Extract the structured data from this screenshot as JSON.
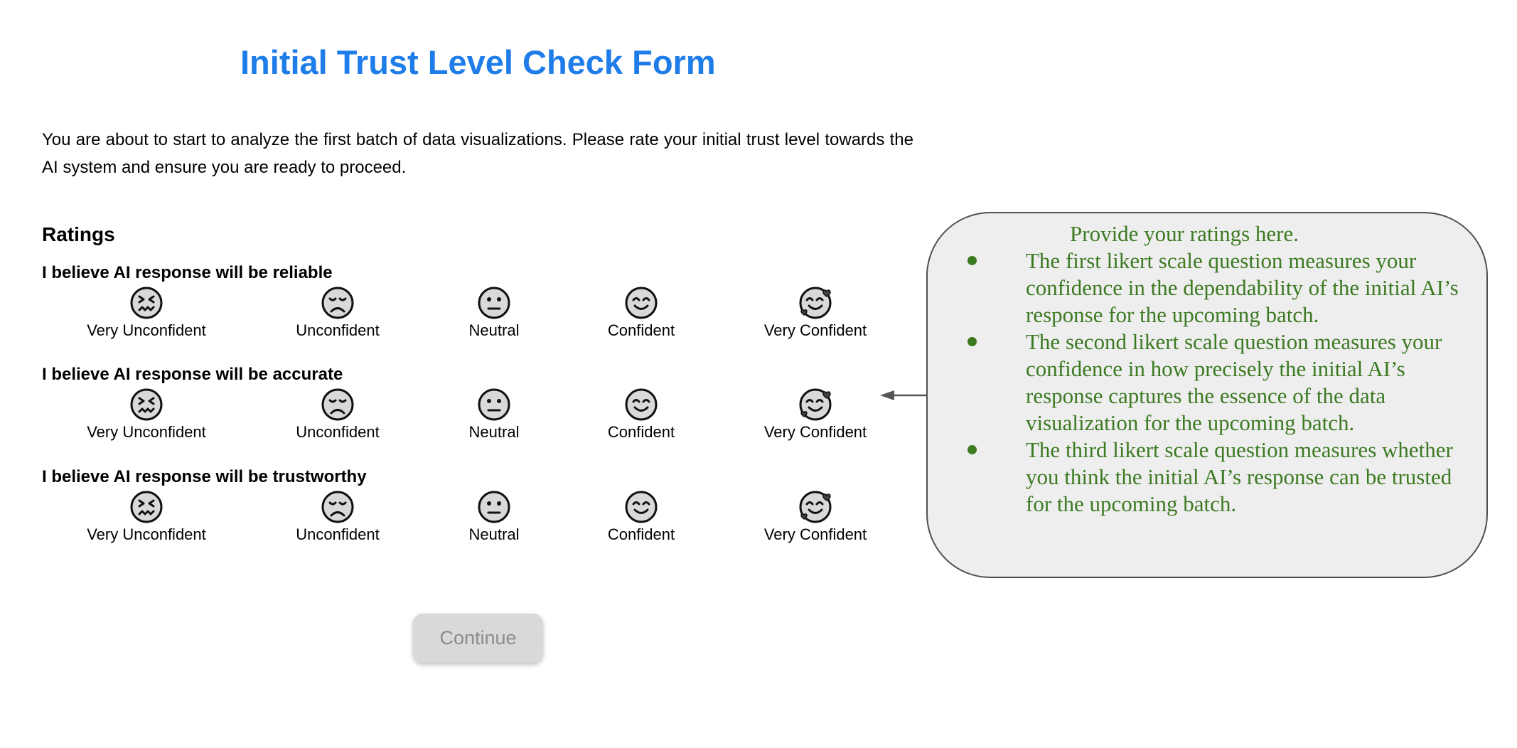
{
  "form": {
    "title": "Initial Trust Level Check Form",
    "intro": "You are about to start to analyze the first batch of data visualizations. Please rate your initial trust level towards the AI system and ensure you are ready to proceed.",
    "ratings_heading": "Ratings",
    "questions": [
      {
        "label": "I believe AI response will be reliable"
      },
      {
        "label": "I believe AI response will be accurate"
      },
      {
        "label": "I believe AI response will be trustworthy"
      }
    ],
    "scale": [
      {
        "label": "Very Unconfident",
        "icon": "very-unconfident-face-icon"
      },
      {
        "label": "Unconfident",
        "icon": "unconfident-face-icon"
      },
      {
        "label": "Neutral",
        "icon": "neutral-face-icon"
      },
      {
        "label": "Confident",
        "icon": "confident-face-icon"
      },
      {
        "label": "Very Confident",
        "icon": "very-confident-face-icon"
      }
    ],
    "continue_label": "Continue"
  },
  "callout": {
    "title": "Provide your ratings here.",
    "items": [
      "The first likert scale question measures your confidence in the dependability of the initial AI’s response for the upcoming batch.",
      "The second likert scale question measures your confidence in how precisely the initial AI’s response captures the essence of the data visualization for the upcoming batch.",
      "The third likert scale question measures whether you think the initial AI’s response can be trusted for the upcoming batch."
    ]
  },
  "colors": {
    "title": "#1f7de9",
    "callout_text": "#3c7a22",
    "callout_background": "#eeeeee",
    "face_fill": "#d9d9d9",
    "button_background": "#d9d9d9",
    "button_text": "#8c8c8c"
  }
}
